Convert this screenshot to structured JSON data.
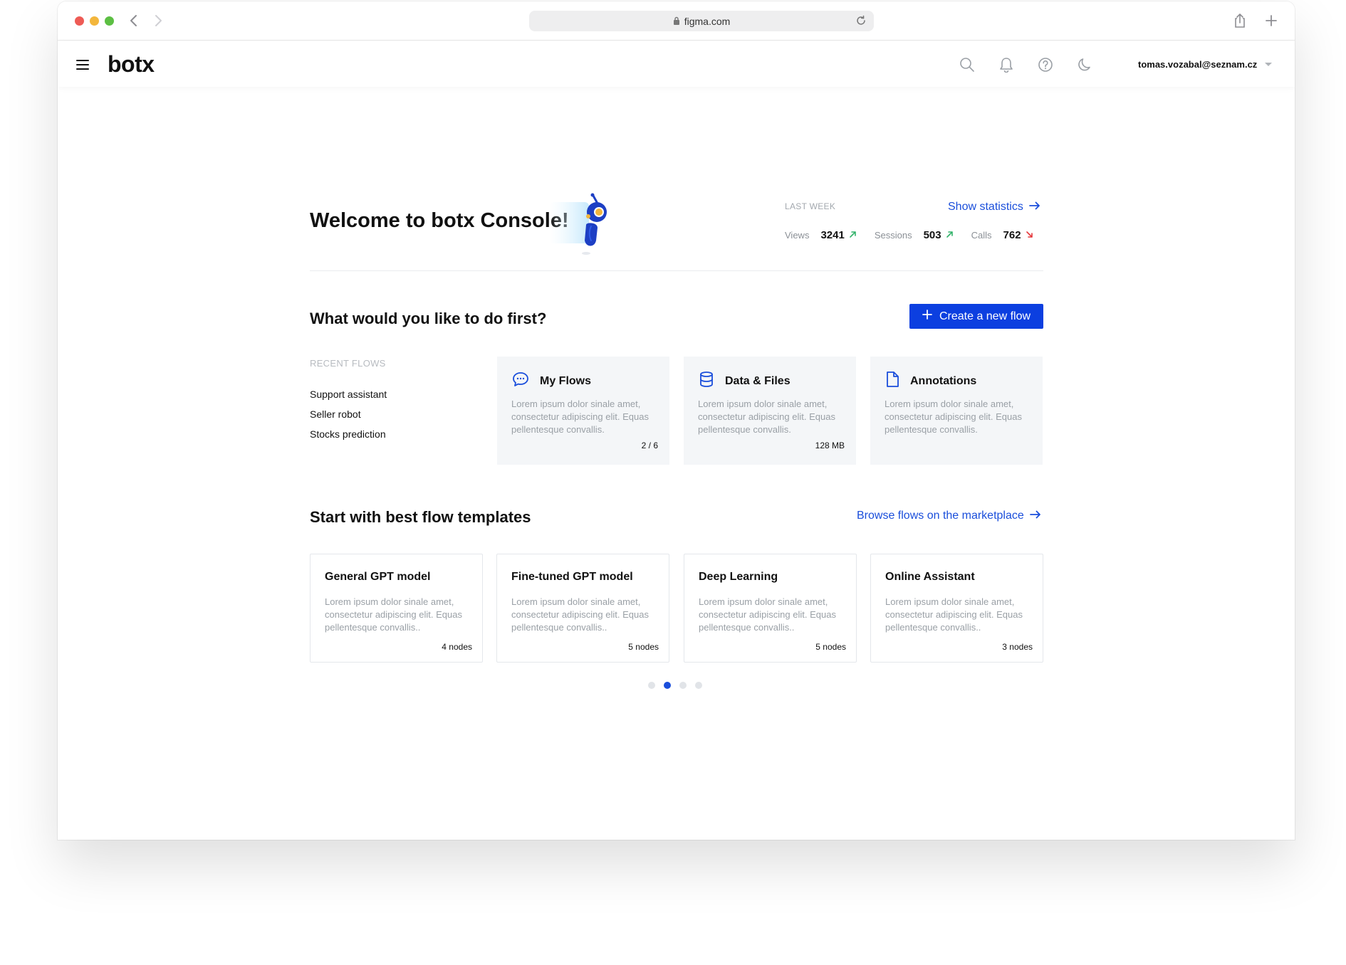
{
  "browser": {
    "url": "figma.com"
  },
  "header": {
    "logo": "botx",
    "user_email": "tomas.vozabal@seznam.cz"
  },
  "welcome": {
    "title": "Welcome to botx Console!"
  },
  "stats": {
    "period_label": "LAST WEEK",
    "show_statistics": "Show statistics",
    "items": [
      {
        "label": "Views",
        "value": "3241",
        "trend": "up"
      },
      {
        "label": "Sessions",
        "value": "503",
        "trend": "up"
      },
      {
        "label": "Calls",
        "value": "762",
        "trend": "down"
      }
    ]
  },
  "colors": {
    "accent": "#0c3fe0",
    "link": "#1a4edb",
    "trend_up": "#33b36b",
    "trend_down": "#e5383b"
  },
  "first": {
    "title": "What would you like to do first?",
    "create_button": "Create a new flow",
    "recent_label": "RECENT FLOWS",
    "recent": [
      "Support assistant",
      "Seller robot",
      "Stocks prediction"
    ],
    "tiles": [
      {
        "icon": "chat-icon",
        "title": "My Flows",
        "desc": "Lorem ipsum dolor sinale amet, consectetur adipiscing elit. Equas pellentesque convallis.",
        "meta": "2 / 6"
      },
      {
        "icon": "database-icon",
        "title": "Data & Files",
        "desc": "Lorem ipsum dolor sinale amet, consectetur adipiscing elit. Equas pellentesque convallis.",
        "meta": "128 MB"
      },
      {
        "icon": "document-icon",
        "title": "Annotations",
        "desc": "Lorem ipsum dolor sinale amet, consectetur adipiscing elit. Equas pellentesque convallis.",
        "meta": ""
      }
    ]
  },
  "templates": {
    "title": "Start with best flow templates",
    "browse_link": "Browse flows on the marketplace",
    "items": [
      {
        "title": "General GPT model",
        "desc": "Lorem ipsum dolor sinale amet, consectetur adipiscing elit. Equas pellentesque convallis..",
        "meta": "4 nodes"
      },
      {
        "title": "Fine-tuned GPT model",
        "desc": "Lorem ipsum dolor sinale amet, consectetur adipiscing elit. Equas pellentesque convallis..",
        "meta": "5 nodes"
      },
      {
        "title": "Deep Learning",
        "desc": "Lorem ipsum dolor sinale amet, consectetur adipiscing elit. Equas pellentesque convallis..",
        "meta": "5 nodes"
      },
      {
        "title": "Online Assistant",
        "desc": "Lorem ipsum dolor sinale amet, consectetur adipiscing elit. Equas pellentesque convallis..",
        "meta": "3 nodes"
      }
    ],
    "pagination": {
      "pages": 4,
      "active_index": 1
    }
  }
}
